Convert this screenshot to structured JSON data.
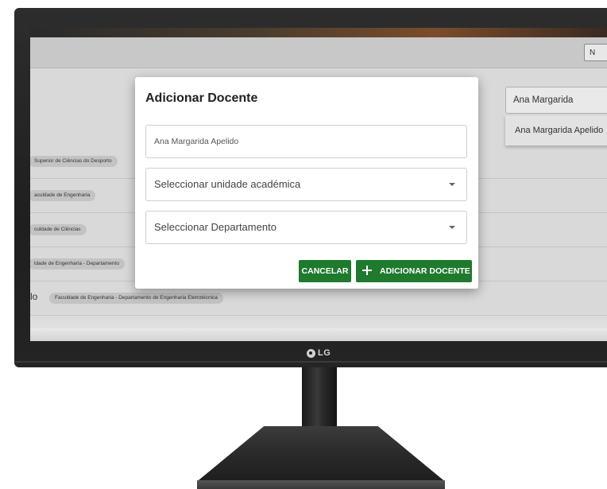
{
  "brand": {
    "logo_text": "LG"
  },
  "header": {
    "button_label": "N"
  },
  "search": {
    "value": "Ana Margarida",
    "suggestion": "Ana Margarida Apelido"
  },
  "rows": [
    {
      "name": "",
      "chip": "Superior de Ciências do Desporto"
    },
    {
      "name": "",
      "chip": "aculdade de Engenharia"
    },
    {
      "name": "",
      "chip": "culdade de Ciências"
    },
    {
      "name": "",
      "chip": "ldade de Engenharia - Departamento"
    },
    {
      "name": "lo",
      "chip": "Faculdade de Engenharia - Departamento de Engenharia Eletrotécnica"
    }
  ],
  "modal": {
    "title": "Adicionar Docente",
    "name_field": {
      "value": "Ana Margarida Apelido"
    },
    "unit_select": {
      "placeholder": "Seleccionar unidade académica"
    },
    "department_select": {
      "placeholder": "Seleccionar Departamento"
    },
    "cancel_label": "CANCELAR",
    "add_label": "ADICIONAR DOCENTE"
  },
  "colors": {
    "primary_button": "#1f7a2e",
    "overlay": "#d9d9d9",
    "monitor_bezel": "#242424"
  },
  "icons": {
    "add": "plus-icon",
    "dropdown": "chevron-down-icon",
    "brand": "lg-logo-icon"
  }
}
